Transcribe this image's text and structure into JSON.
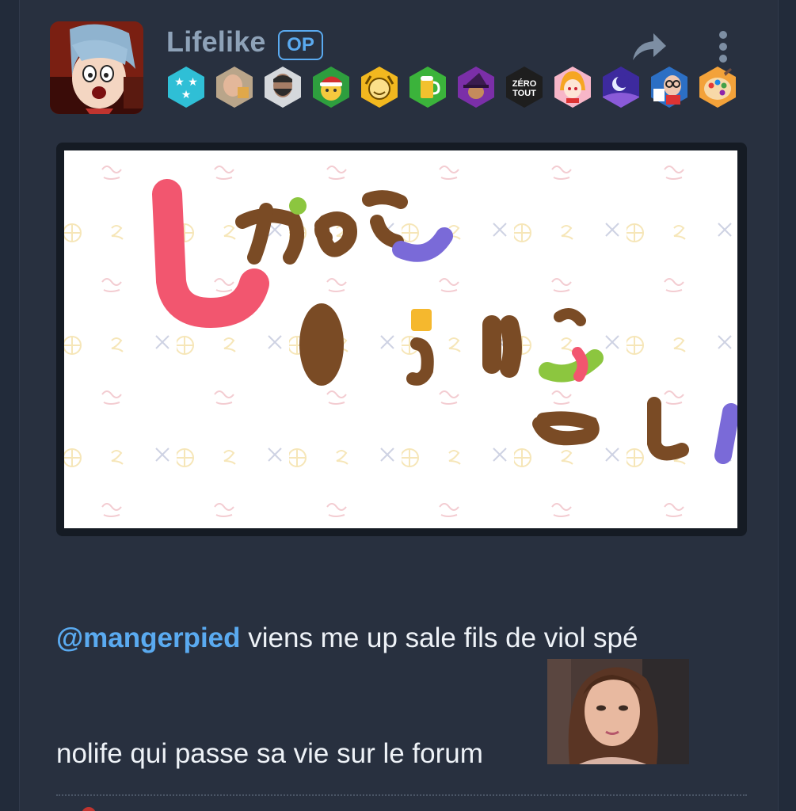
{
  "post": {
    "author": "Lifelike",
    "op_label": "OP",
    "mention": "@mangerpied",
    "line1_rest": " viens me up sale fils de viol spé",
    "line2": "nolife qui passe sa vie sur le forum"
  },
  "image_text": {
    "zero_tout_line1": "ZÉRO",
    "zero_tout_line2": "TOUT"
  },
  "badges": [
    "stars-badge-icon",
    "bald-man-badge-icon",
    "bearded-man-badge-icon",
    "santa-hat-badge-icon",
    "mascot-cheer-badge-icon",
    "beer-mug-badge-icon",
    "wizard-hat-badge-icon",
    "zero-tout-badge-icon",
    "anime-girl-badge-icon",
    "moon-night-badge-icon",
    "man-with-glasses-badge-icon",
    "paint-palette-badge-icon"
  ],
  "colors": {
    "background": "#222b3a",
    "card": "#28303f",
    "username": "#8ea2b8",
    "accent_blue": "#5aaaf0",
    "text": "#eef2f7"
  }
}
